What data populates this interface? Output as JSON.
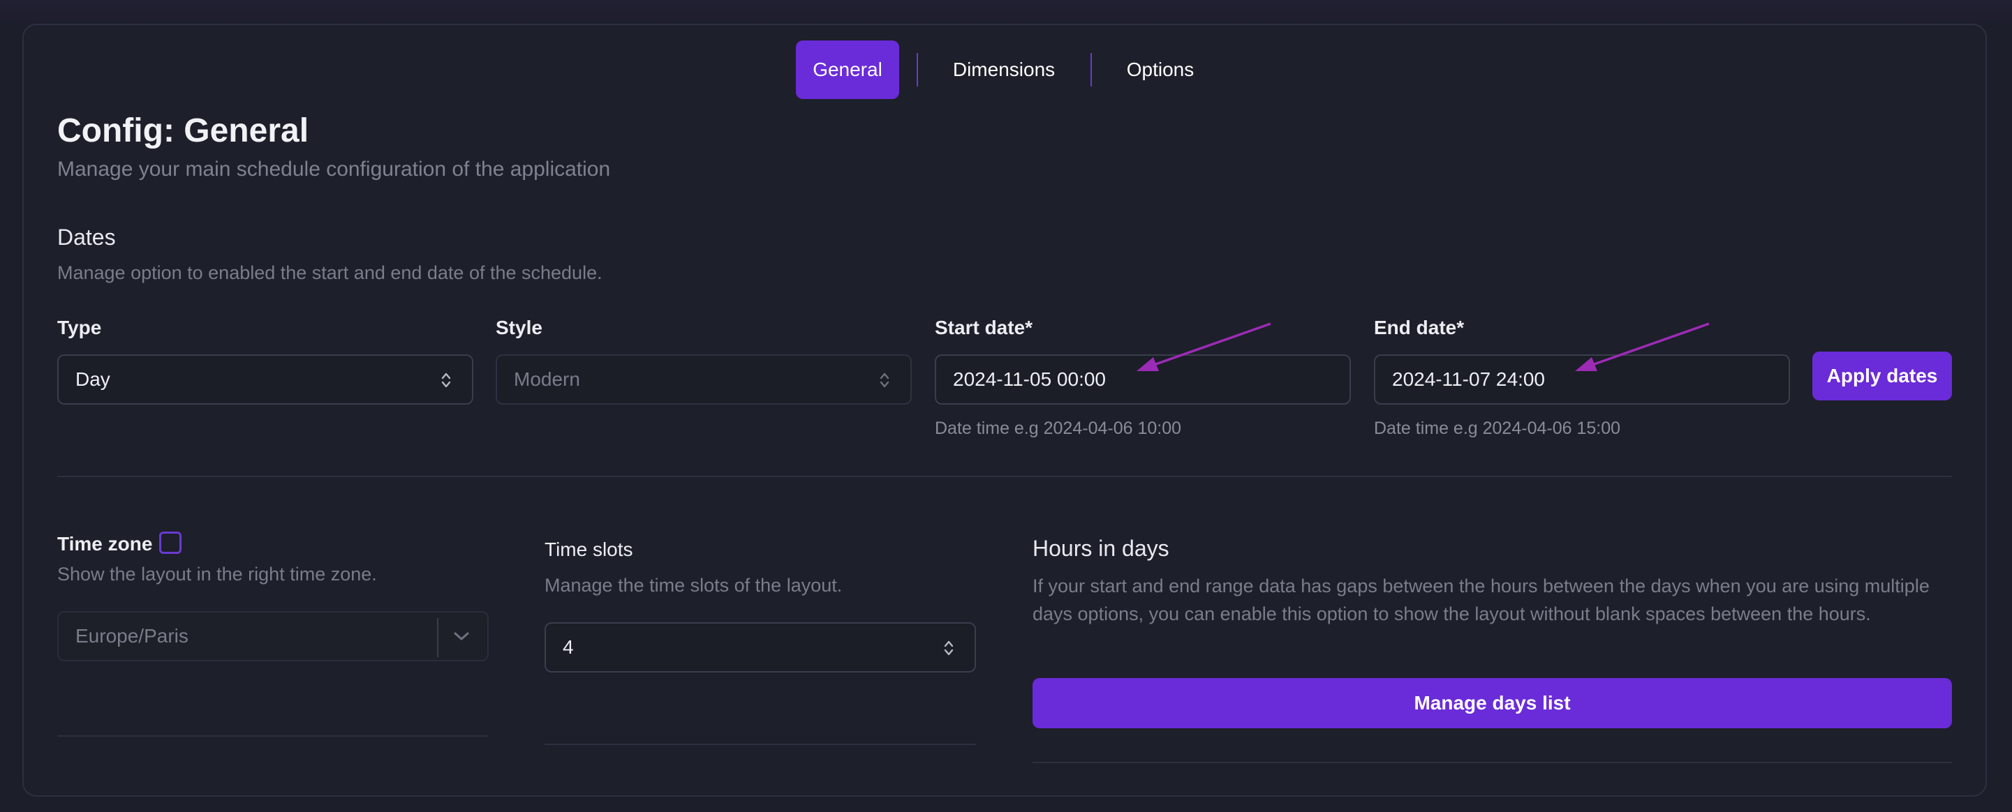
{
  "tabs": [
    {
      "label": "General",
      "active": true
    },
    {
      "label": "Dimensions",
      "active": false
    },
    {
      "label": "Options",
      "active": false
    }
  ],
  "header": {
    "title": "Config: General",
    "subtitle": "Manage your main schedule configuration of the application"
  },
  "dates": {
    "title": "Dates",
    "description": "Manage option to enabled the start and end date of the schedule.",
    "type": {
      "label": "Type",
      "value": "Day"
    },
    "style": {
      "label": "Style",
      "value": "Modern"
    },
    "start": {
      "label": "Start date*",
      "value": "2024-11-05 00:00",
      "help": "Date time e.g 2024-04-06 10:00"
    },
    "end": {
      "label": "End date*",
      "value": "2024-11-07 24:00",
      "help": "Date time e.g 2024-04-06 15:00"
    },
    "apply_label": "Apply dates"
  },
  "timezone": {
    "label": "Time zone",
    "description": "Show the layout in the right time zone.",
    "value": "Europe/Paris"
  },
  "time_slots": {
    "label": "Time slots",
    "description": "Manage the time slots of the layout.",
    "value": "4"
  },
  "hours_in_days": {
    "title": "Hours in days",
    "description": "If your start and end range data has gaps between the hours between the days when you are using multiple days options, you can enable this option to show the layout without blank spaces between the hours.",
    "button_label": "Manage days list"
  },
  "colors": {
    "accent": "#6a2bd8",
    "annotation_arrow": "#9c2bb5"
  }
}
